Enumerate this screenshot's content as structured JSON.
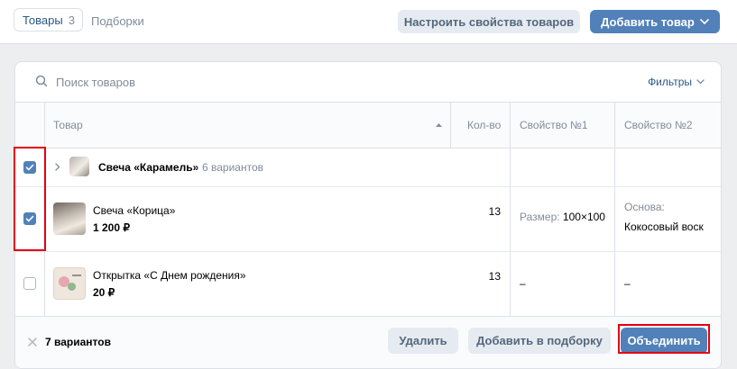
{
  "tabs": {
    "products_label": "Товары",
    "products_count": "3",
    "collections_label": "Подборки"
  },
  "header": {
    "configure_button": "Настроить свойства товаров",
    "add_button": "Добавить товар"
  },
  "search": {
    "placeholder": "Поиск товаров",
    "filters_label": "Фильтры"
  },
  "table": {
    "columns": {
      "product": "Товар",
      "qty": "Кол-во",
      "prop1": "Свойство №1",
      "prop2": "Свойство №2"
    },
    "group": {
      "name": "Свеча «Карамель»",
      "separator": "·",
      "variants": "6 вариантов",
      "checked": true
    },
    "rows": [
      {
        "name": "Свеча «Корица»",
        "price": "1 200 ₽",
        "qty": "13",
        "prop1_label": "Размер:",
        "prop1_value": "100×100",
        "prop2_label": "Основа:",
        "prop2_value": "Кокосовый воск",
        "checked": true
      },
      {
        "name": "Открытка «С Днем рождения»",
        "price": "20 ₽",
        "qty": "13",
        "prop1_value": "–",
        "prop2_value": "–",
        "checked": false
      }
    ]
  },
  "footer": {
    "selected_count": "7 вариантов",
    "delete_button": "Удалить",
    "add_to_collection_button": "Добавить в подборку",
    "merge_button": "Объединить"
  },
  "colors": {
    "accent": "#5181b8",
    "highlight": "#e5000e"
  }
}
